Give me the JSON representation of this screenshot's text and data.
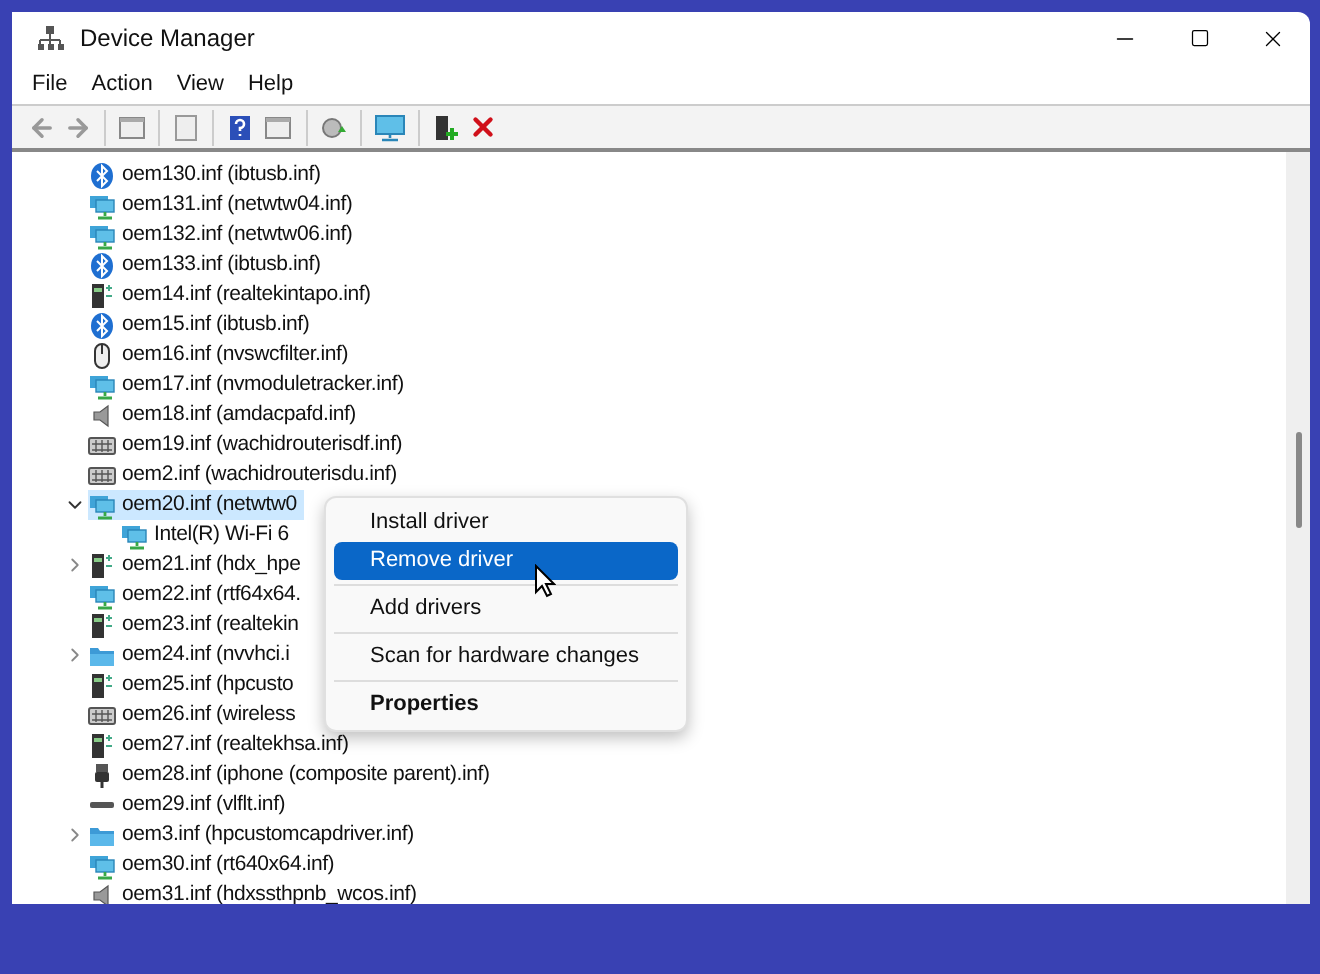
{
  "window": {
    "title": "Device Manager"
  },
  "menu_bar": [
    "File",
    "Action",
    "View",
    "Help"
  ],
  "tree": [
    {
      "label": "oem130.inf (ibtusb.inf)",
      "kind": "bluetooth",
      "selected": false
    },
    {
      "label": "oem131.inf (netwtw04.inf)",
      "kind": "network",
      "selected": false
    },
    {
      "label": "oem132.inf (netwtw06.inf)",
      "kind": "network",
      "selected": false
    },
    {
      "label": "oem133.inf (ibtusb.inf)",
      "kind": "bluetooth",
      "selected": false
    },
    {
      "label": "oem14.inf (realtekintapo.inf)",
      "kind": "device",
      "selected": false
    },
    {
      "label": "oem15.inf (ibtusb.inf)",
      "kind": "bluetooth",
      "selected": false
    },
    {
      "label": "oem16.inf (nvswcfilter.inf)",
      "kind": "mouse",
      "selected": false
    },
    {
      "label": "oem17.inf (nvmoduletracker.inf)",
      "kind": "network",
      "selected": false
    },
    {
      "label": "oem18.inf (amdacpafd.inf)",
      "kind": "speaker",
      "selected": false
    },
    {
      "label": "oem19.inf (wachidrouterisdf.inf)",
      "kind": "hid",
      "selected": false
    },
    {
      "label": "oem2.inf (wachidrouterisdu.inf)",
      "kind": "hid",
      "selected": false
    },
    {
      "label": "oem20.inf (netwtw0",
      "kind": "network",
      "selected": true,
      "expanded": true,
      "children": [
        {
          "label": "Intel(R) Wi-Fi 6",
          "kind": "network",
          "selected": false
        }
      ]
    },
    {
      "label": "oem21.inf (hdx_hpe",
      "kind": "device",
      "selected": false,
      "expanded": false
    },
    {
      "label": "oem22.inf (rtf64x64.",
      "kind": "network",
      "selected": false
    },
    {
      "label": "oem23.inf (realtekin",
      "kind": "device",
      "selected": false
    },
    {
      "label": "oem24.inf (nvvhci.i",
      "kind": "folder",
      "selected": false,
      "expanded": false
    },
    {
      "label": "oem25.inf (hpcusto",
      "kind": "device",
      "selected": false
    },
    {
      "label": "oem26.inf (wireless",
      "kind": "hid",
      "selected": false
    },
    {
      "label": "oem27.inf (realtekhsa.inf)",
      "kind": "device",
      "selected": false
    },
    {
      "label": "oem28.inf (iphone (composite parent).inf)",
      "kind": "usb",
      "selected": false
    },
    {
      "label": "oem29.inf (vlflt.inf)",
      "kind": "disk",
      "selected": false
    },
    {
      "label": "oem3.inf (hpcustomcapdriver.inf)",
      "kind": "folder",
      "selected": false,
      "expanded": false
    },
    {
      "label": "oem30.inf (rt640x64.inf)",
      "kind": "network",
      "selected": false
    },
    {
      "label": "oem31.inf (hdxssthpnb_wcos.inf)",
      "kind": "speaker",
      "selected": false
    }
  ],
  "context_menu": [
    [
      {
        "label": "Install driver",
        "selected": false,
        "bold": false
      },
      {
        "label": "Remove driver",
        "selected": true,
        "bold": false
      }
    ],
    [
      {
        "label": "Add drivers",
        "selected": false,
        "bold": false
      }
    ],
    [
      {
        "label": "Scan for hardware changes",
        "selected": false,
        "bold": false
      }
    ],
    [
      {
        "label": "Properties",
        "selected": false,
        "bold": true
      }
    ]
  ]
}
